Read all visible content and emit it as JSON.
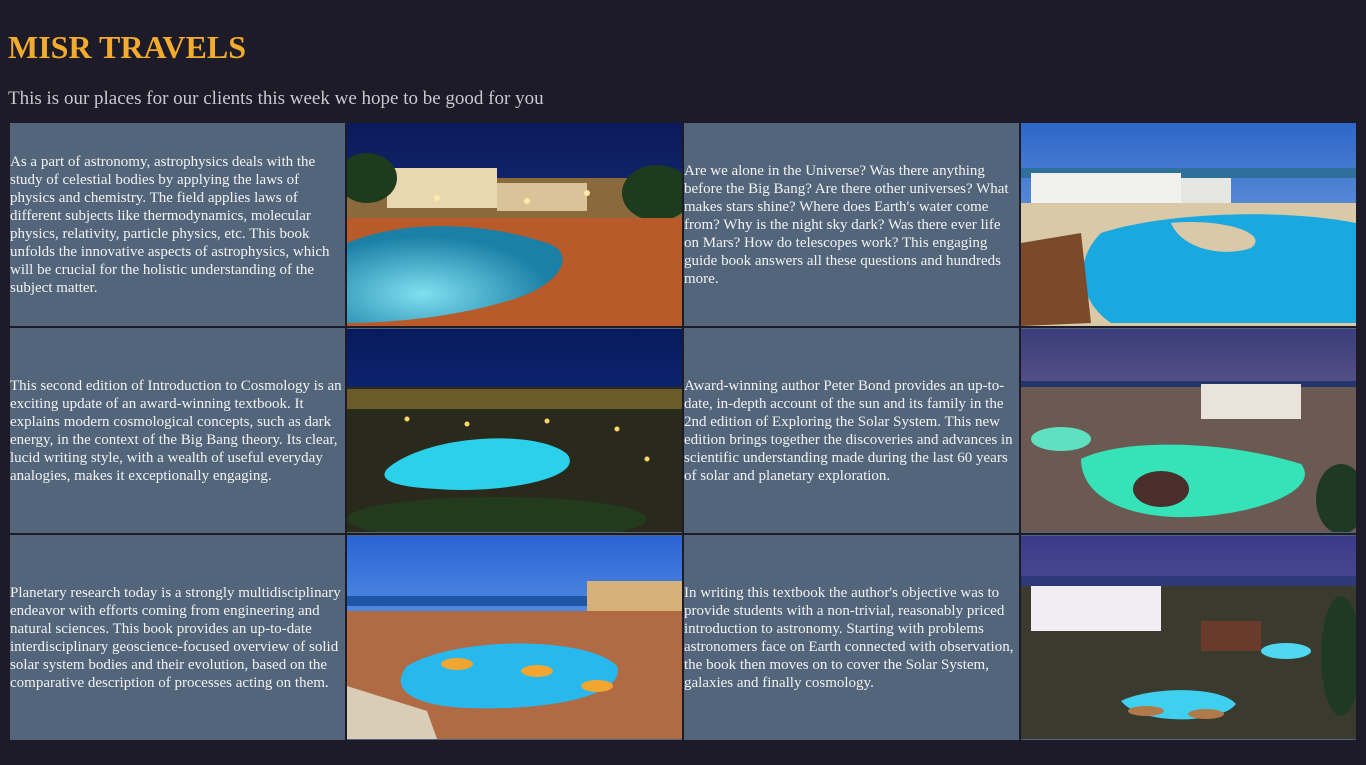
{
  "header": {
    "title": "MISR TRAVELS",
    "subtitle": "This is our places for our clients this week we hope to be good for you"
  },
  "rows": [
    {
      "cells": [
        {
          "text": "As a part of astronomy, astrophysics deals with the study of celestial bodies by applying the laws of physics and chemistry. The field applies laws of different subjects like thermodynamics, molecular physics, relativity, particle physics, etc. This book unfolds the innovative aspects of astrophysics, which will be crucial for the holistic understanding of the subject matter."
        },
        {
          "image": "resort-pool-night-photo"
        },
        {
          "text": "Are we alone in the Universe? Was there anything before the Big Bang? Are there other universes? What makes stars shine? Where does Earth's water come from? Why is the night sky dark? Was there ever life on Mars? How do telescopes work? This engaging guide book answers all these questions and hundreds more."
        },
        {
          "image": "resort-pool-day-photo"
        }
      ]
    },
    {
      "cells": [
        {
          "text": "This second edition of Introduction to Cosmology is an exciting update of an award-winning textbook. It explains modern cosmological concepts, such as dark energy, in the context of the Big Bang theory. Its clear, lucid writing style, with a wealth of useful everyday analogies, makes it exceptionally engaging."
        },
        {
          "image": "resort-lagoon-night-photo"
        },
        {
          "text": "Award-winning author Peter Bond provides an up-to-date, in-depth account of the sun and its family in the 2nd edition of Exploring the Solar System. This new edition brings together the discoveries and advances in scientific understanding made during the last 60 years of solar and planetary exploration."
        },
        {
          "image": "resort-green-pools-dusk-photo"
        }
      ]
    },
    {
      "cells": [
        {
          "text": "Planetary research today is a strongly multidisciplinary endeavor with efforts coming from engineering and natural sciences. This book provides an up-to-date interdisciplinary geoscience-focused overview of solid solar system bodies and their evolution, based on the comparative description of processes acting on them."
        },
        {
          "image": "resort-pool-umbrellas-photo"
        },
        {
          "text": "In writing this textbook the author's objective was to provide students with a non-trivial, reasonably priced introduction to astronomy. Starting with problems astronomers face on Earth connected with observation, the book then moves on to cover the Solar System, galaxies and finally cosmology."
        },
        {
          "image": "resort-palms-evening-photo"
        }
      ]
    }
  ]
}
